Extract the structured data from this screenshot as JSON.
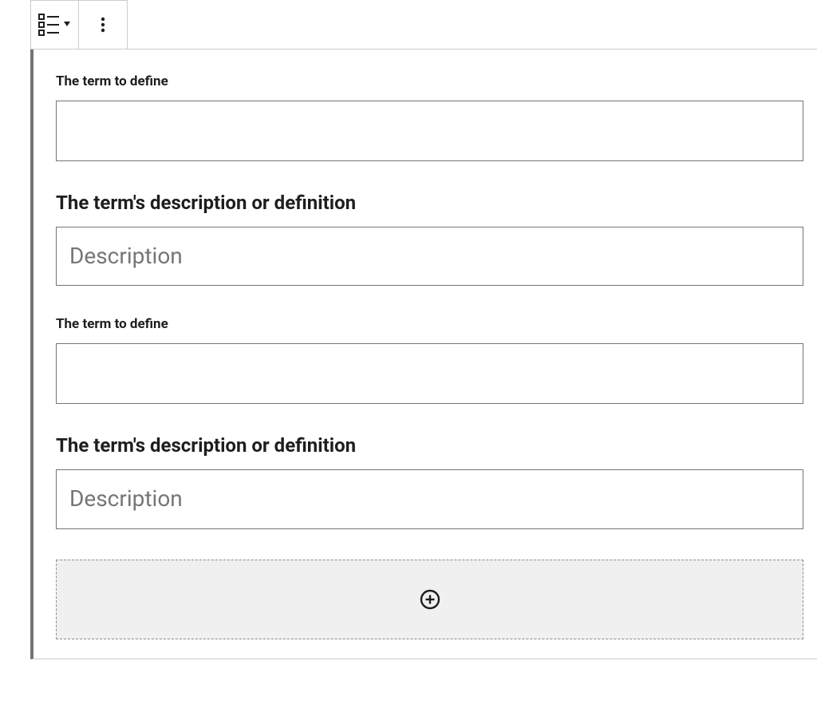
{
  "toolbar": {
    "block_type_icon": "definition-list",
    "more_icon": "more-vertical"
  },
  "sections": [
    {
      "term_label": "The term to define",
      "term_value": "",
      "desc_label": "The term's description or definition",
      "desc_value": "",
      "desc_placeholder": "Description"
    },
    {
      "term_label": "The term to define",
      "term_value": "",
      "desc_label": "The term's description or definition",
      "desc_value": "",
      "desc_placeholder": "Description"
    }
  ],
  "appender": {
    "icon": "plus-circle"
  }
}
